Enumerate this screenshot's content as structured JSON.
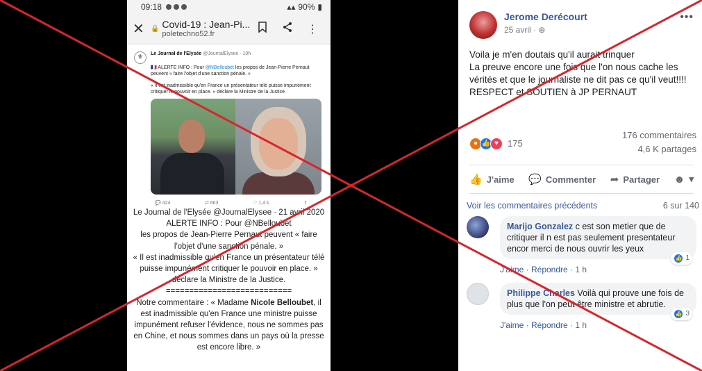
{
  "phone": {
    "status_time": "09:18",
    "battery": "90%",
    "page_title": "Covid-19 : Jean-Pi...",
    "page_url": "poletechno52.fr",
    "tweet": {
      "account_name": "Le Journal de l'Elysée",
      "account_handle": "@JournalElysee · 10h",
      "line1_prefix": "🇫🇷 ALERTE INFO : Pour ",
      "line1_mention": "@NBelloubet",
      "line1_suffix": " les propos de Jean-Pierre Pernaut peuvent « faire l'objet d'une sanction pénale. »",
      "line2": "« Il est inadmissible qu'en France un présentateur télé puisse impunément critiquer le pouvoir en place. » déclare la Ministre de la Justice.",
      "replies": "424",
      "retweets": "663",
      "likes": "1,4 k"
    },
    "caption": [
      "Le Journal de l'Elysée @JournalElysee · 21 avril 2020",
      "ALERTE INFO : Pour @NBelloubet",
      "les propos de Jean-Pierre Pernaut peuvent « faire l'objet d'une sanction pénale. »",
      "« Il est inadmissible qu'en France un présentateur télé puisse impunément critiquer le pouvoir en place. » déclare la Ministre de la Justice.",
      "==========================="
    ],
    "comment_prefix": "Notre commentaire : « Madame ",
    "comment_bold": "Nicole Belloubet",
    "comment_suffix": ", il est inadmissible qu'en France une ministre puisse impunément refuser l'évidence, nous ne sommes pas en Chine, et nous sommes dans un pays où la presse est encore libre. »"
  },
  "post": {
    "author": "Jerome Derécourt",
    "date": "25 avril · ",
    "more": "•••",
    "text": [
      "Voila je m'en doutais qu'il aurait trinquer",
      "La preuve encore une fois que l'on nous cache les vérités et que le journaliste ne dit pas ce qu'il veut!!!!",
      "RESPECT et SOUTIEN à JP PERNAUT"
    ],
    "reactions_count": "175",
    "comments_count": "176 commentaires",
    "shares_count": "4,6 K partages",
    "like_label": "J'aime",
    "comment_label": "Commenter",
    "share_label": "Partager",
    "previous_comments_label": "Voir les commentaires précédents",
    "comments_pager": "6 sur 140",
    "comments": [
      {
        "name": "Marijo Gonzalez",
        "text": " c est son metier que de critiquer il n est pas seulement presentateur encor merci de nous ouvrir les yeux",
        "likes": "1",
        "like_action": "J'aime",
        "reply_action": "Répondre",
        "time": "1 h"
      },
      {
        "name": "Philippe Charles",
        "text": " Voilà qui prouve une fois de plus que l'on peut être ministre et abrutie.",
        "likes": "3",
        "like_action": "J'aime",
        "reply_action": "Répondre",
        "time": "1 h"
      }
    ]
  },
  "colors": {
    "cross": "#d6262c",
    "fb_link": "#385898",
    "like_blue": "#1877f2"
  }
}
